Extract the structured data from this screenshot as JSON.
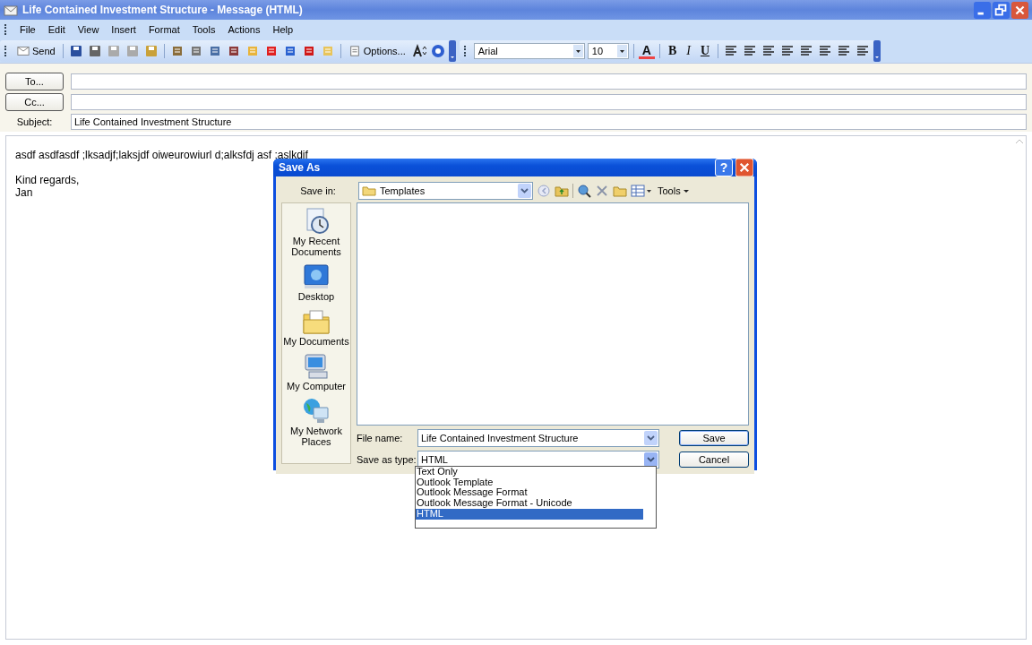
{
  "window": {
    "title": "Life Contained Investment Structure - Message (HTML)"
  },
  "menu": [
    "File",
    "Edit",
    "View",
    "Insert",
    "Format",
    "Tools",
    "Actions",
    "Help"
  ],
  "toolbar": {
    "send": "Send",
    "options": "Options...",
    "font": "Arial",
    "size": "10",
    "bold": "B",
    "italic": "I",
    "underline": "U",
    "font_color": "A"
  },
  "header": {
    "to_button": "To...",
    "cc_button": "Cc...",
    "subject_label": "Subject:",
    "subject": "Life Contained Investment Structure"
  },
  "body": [
    "asdf asdfasdf ;lksadjf;laksjdf oiweurowiurl d;alksfdj asf ;aslkdjf",
    "Kind regards,",
    "Jan"
  ],
  "dialog": {
    "title": "Save As",
    "help": "?",
    "save_in_label": "Save in:",
    "save_in": "Templates",
    "tools": "Tools",
    "places": [
      {
        "label": "My Recent Documents",
        "kind": "recent"
      },
      {
        "label": "Desktop",
        "kind": "desktop"
      },
      {
        "label": "My Documents",
        "kind": "documents"
      },
      {
        "label": "My Computer",
        "kind": "computer"
      },
      {
        "label": "My Network Places",
        "kind": "network"
      }
    ],
    "file_name_label": "File name:",
    "file_name": "Life Contained Investment Structure",
    "type_label": "Save as type:",
    "type": "HTML",
    "save": "Save",
    "cancel": "Cancel",
    "type_options": [
      {
        "label": "Text Only",
        "selected": false
      },
      {
        "label": "Outlook Template",
        "selected": false
      },
      {
        "label": "Outlook Message Format",
        "selected": false
      },
      {
        "label": "Outlook Message Format - Unicode",
        "selected": false
      },
      {
        "label": "HTML",
        "selected": true
      }
    ]
  }
}
